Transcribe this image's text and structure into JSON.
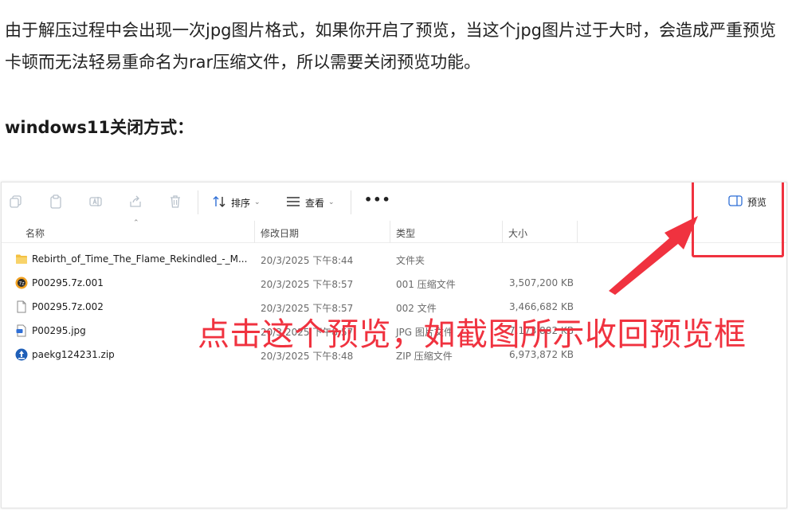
{
  "article": {
    "paragraph": "由于解压过程中会出现一次jpg图片格式，如果你开启了预览，当这个jpg图片过于大时，会造成严重预览卡顿而无法轻易重命名为rar压缩文件，所以需要关闭预览功能。",
    "heading": "windows11关闭方式："
  },
  "toolbar": {
    "sort_label": "排序",
    "view_label": "查看",
    "more_label": "•••",
    "preview_label": "预览"
  },
  "columns": {
    "name": "名称",
    "modified": "修改日期",
    "type": "类型",
    "size": "大小"
  },
  "files": [
    {
      "name": "Rebirth_of_Time_The_Flame_Rekindled_-_M...",
      "date": "20/3/2025 下午8:44",
      "type": "文件夹",
      "size": "",
      "icon": "folder-icon"
    },
    {
      "name": "P00295.7z.001",
      "date": "20/3/2025 下午8:57",
      "type": "001 压缩文件",
      "size": "3,507,200 KB",
      "icon": "archive-icon"
    },
    {
      "name": "P00295.7z.002",
      "date": "20/3/2025 下午8:57",
      "type": "002 文件",
      "size": "3,466,682 KB",
      "icon": "file-icon"
    },
    {
      "name": "P00295.jpg",
      "date": "20/3/2025 下午8:57",
      "type": "JPG 图片文件",
      "size": "7,173,882 KB",
      "icon": "image-file-icon"
    },
    {
      "name": "paekg124231.zip",
      "date": "20/3/2025 下午8:48",
      "type": "ZIP 压缩文件",
      "size": "6,973,872 KB",
      "icon": "zip-archive-icon"
    }
  ],
  "annotation": {
    "text": "点击这个预览，如截图所示收回预览框",
    "color": "#f0323f"
  },
  "colors": {
    "folder": "#f4c142",
    "accent_blue": "#2f6fd6",
    "annotation_red": "#f0323f"
  }
}
